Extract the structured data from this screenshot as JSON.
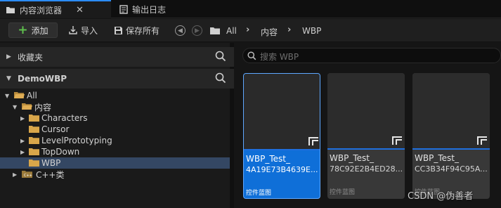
{
  "tabs": [
    {
      "label": "内容浏览器",
      "active": true
    },
    {
      "label": "输出日志",
      "active": false
    }
  ],
  "toolbar": {
    "add_label": "添加",
    "import_label": "导入",
    "save_all_label": "保存所有"
  },
  "breadcrumb": [
    "All",
    "内容",
    "WBP"
  ],
  "left": {
    "favorites_title": "收藏夹",
    "project_title": "DemoWBP",
    "tree": [
      {
        "label": "All",
        "expanded": true
      },
      {
        "label": "内容",
        "expanded": true
      },
      {
        "label": "Characters"
      },
      {
        "label": "Cursor"
      },
      {
        "label": "LevelPrototyping"
      },
      {
        "label": "TopDown"
      },
      {
        "label": "WBP",
        "selected": true
      },
      {
        "label": "C++类"
      }
    ]
  },
  "search": {
    "placeholder": "搜索 WBP"
  },
  "assets": [
    {
      "name_line1": "WBP_Test_",
      "name_line2": "4A19E73B4639E...",
      "type": "控件蓝图",
      "selected": true
    },
    {
      "name_line1": "WBP_Test_",
      "name_line2": "78C92E2B4ED28...",
      "type": "控件蓝图",
      "selected": false
    },
    {
      "name_line1": "WBP_Test_",
      "name_line2": "CC3B34F94C95A...",
      "type": "控件蓝图",
      "selected": false
    }
  ],
  "watermark": "CSDN @伪善者",
  "colors": {
    "accent": "#2b8cff",
    "selection_tree": "#344763",
    "selection_card": "#0f6fd8",
    "add_plus": "#5fc04d",
    "folder": "#d8a64a"
  }
}
